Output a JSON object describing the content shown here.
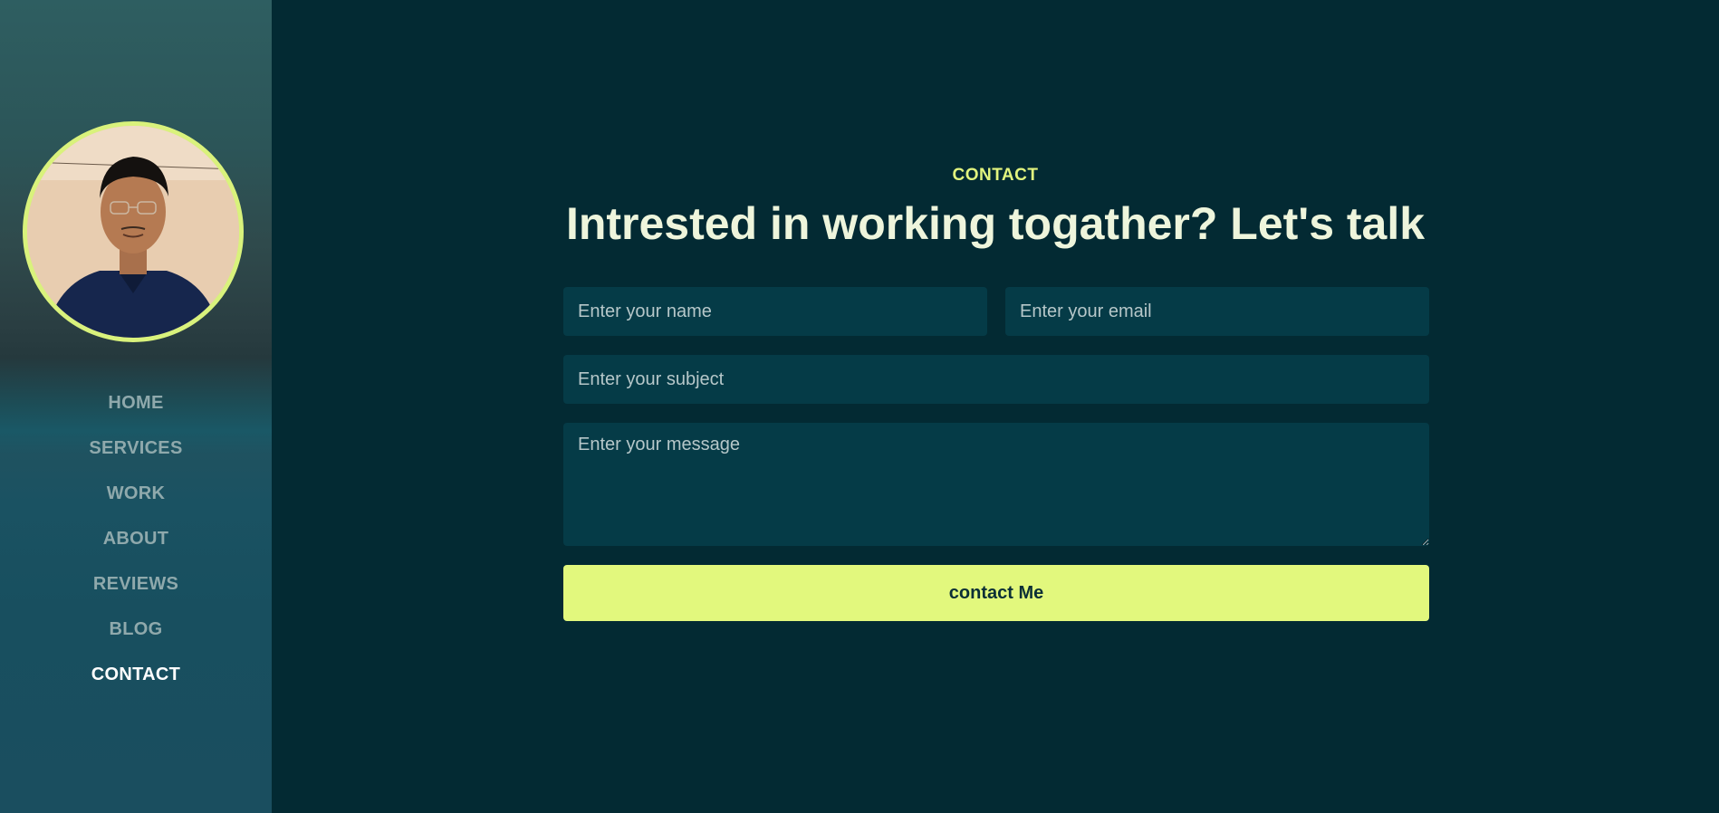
{
  "sidebar": {
    "nav": [
      {
        "label": "HOME"
      },
      {
        "label": "SERVICES"
      },
      {
        "label": "WORK"
      },
      {
        "label": "ABOUT"
      },
      {
        "label": "REVIEWS"
      },
      {
        "label": "BLOG"
      },
      {
        "label": "CONTACT",
        "active": true
      }
    ]
  },
  "contact": {
    "eyebrow": "CONTACT",
    "heading": "Intrested in working togather? Let's talk",
    "form": {
      "name_placeholder": "Enter your name",
      "email_placeholder": "Enter your email",
      "subject_placeholder": "Enter your subject",
      "message_placeholder": "Enter your message",
      "submit_label": "contact Me"
    }
  },
  "colors": {
    "accent": "#e2f87d",
    "background": "#032a33",
    "field_bg": "#053b47",
    "heading": "#eef5dc"
  }
}
